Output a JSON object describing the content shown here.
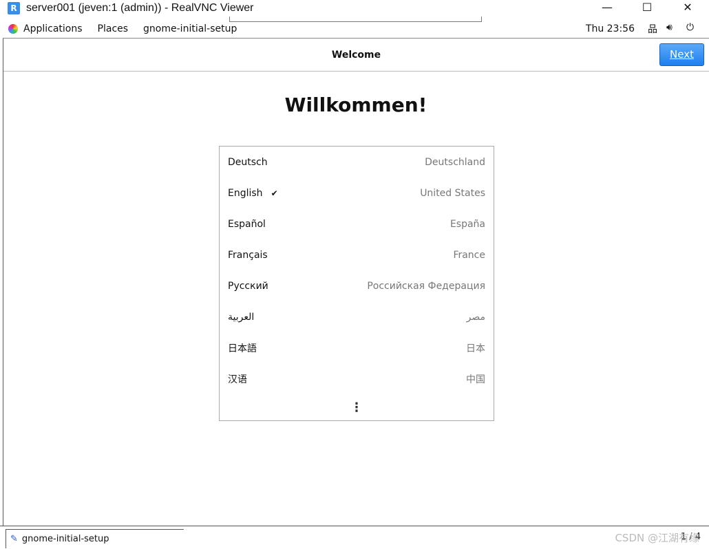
{
  "window": {
    "title": "server001 (jeven:1 (admin)) - RealVNC Viewer",
    "logo": "R"
  },
  "topbar": {
    "menus": [
      "Applications",
      "Places",
      "gnome-initial-setup"
    ],
    "clock": "Thu 23:56"
  },
  "header": {
    "title": "Welcome",
    "next_label": "Next"
  },
  "main": {
    "heading": "Willkommen!",
    "languages": [
      {
        "name": "Deutsch",
        "region": "Deutschland",
        "selected": false
      },
      {
        "name": "English",
        "region": "United States",
        "selected": true
      },
      {
        "name": "Español",
        "region": "España",
        "selected": false
      },
      {
        "name": "Français",
        "region": "France",
        "selected": false
      },
      {
        "name": "Русский",
        "region": "Российская Федерация",
        "selected": false
      },
      {
        "name": "العربية",
        "region": "مصر",
        "selected": false
      },
      {
        "name": "日本語",
        "region": "日本",
        "selected": false
      },
      {
        "name": "汉语",
        "region": "中国",
        "selected": false
      }
    ],
    "more": "⋮",
    "check": "✔"
  },
  "taskbar": {
    "task": "gnome-initial-setup",
    "workspace": "1 / 4",
    "watermark": "CSDN @江湖有缘"
  }
}
